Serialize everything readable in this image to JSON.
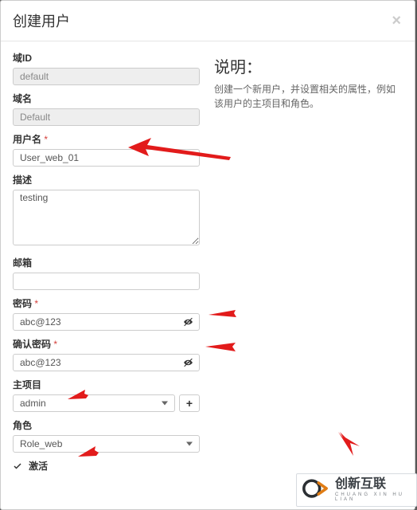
{
  "modal": {
    "title": "创建用户",
    "close_label": "×"
  },
  "description": {
    "heading": "说明：",
    "body": "创建一个新用户，并设置相关的属性，例如该用户的主项目和角色。"
  },
  "form": {
    "domain_id_label": "域ID",
    "domain_id_value": "default",
    "domain_name_label": "域名",
    "domain_name_value": "Default",
    "username_label": "用户名",
    "username_value": "User_web_01",
    "description_label": "描述",
    "description_value": "testing",
    "email_label": "邮箱",
    "email_value": "",
    "password_label": "密码",
    "password_value": "abc@123",
    "confirm_password_label": "确认密码",
    "confirm_password_value": "abc@123",
    "project_label": "主项目",
    "project_value": "admin",
    "role_label": "角色",
    "role_value": "Role_web",
    "active_label": "激活",
    "active_checked": true,
    "required_marker": "*",
    "plus_label": "+"
  },
  "watermark": {
    "name_cn": "创新互联",
    "name_py": "CHUANG XIN HU LIAN"
  }
}
